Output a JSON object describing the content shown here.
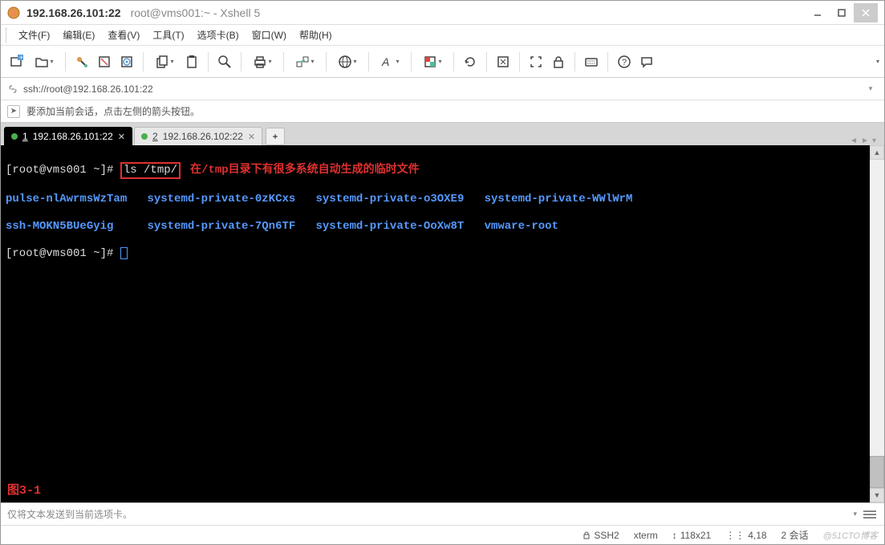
{
  "titlebar": {
    "host": "192.168.26.101:22",
    "title": "root@vms001:~ - Xshell 5"
  },
  "menu": {
    "file": "文件(F)",
    "edit": "编辑(E)",
    "view": "查看(V)",
    "tools": "工具(T)",
    "tabs": "选项卡(B)",
    "window": "窗口(W)",
    "help": "帮助(H)"
  },
  "addrbar": {
    "url": "ssh://root@192.168.26.101:22"
  },
  "infobar": {
    "text": "要添加当前会话，点击左侧的箭头按钮。"
  },
  "tabs": [
    {
      "num": "1",
      "label": "192.168.26.101:22",
      "active": true
    },
    {
      "num": "2",
      "label": "192.168.26.102:22",
      "active": false
    }
  ],
  "tab_add": "+",
  "terminal": {
    "prompt1_user": "[root@vms001 ~]#",
    "cmd": "ls /tmp/",
    "annotation": "在/tmp目录下有很多系统自动生成的临时文件",
    "row1": {
      "c1": "pulse-nlAwrmsWzTam",
      "c2": "systemd-private-0zKCxs",
      "c3": "systemd-private-o3OXE9",
      "c4": "systemd-private-WWlWrM"
    },
    "row2": {
      "c1": "ssh-MOKN5BUeGyig",
      "c2": "systemd-private-7Qn6TF",
      "c3": "systemd-private-OoXw8T",
      "c4": "vmware-root"
    },
    "prompt2_user": "[root@vms001 ~]#",
    "figure_label": "图3-1"
  },
  "composebar": {
    "placeholder": "仅将文本发送到当前选项卡。"
  },
  "statusbar": {
    "proto": "SSH2",
    "termtype": "xterm",
    "size": "118x21",
    "cursor": "4,18",
    "sessions": "2 会话",
    "watermark": "@51CTO博客"
  }
}
